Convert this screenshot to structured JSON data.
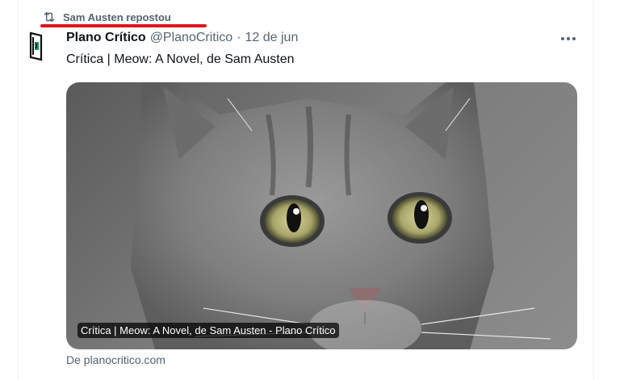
{
  "repost": {
    "label": "Sam Austen repostou",
    "icon": "repost-icon"
  },
  "post": {
    "author_name": "Plano Crítico",
    "author_handle": "@PlanoCritico",
    "separator": "·",
    "date": "12 de jun",
    "more_label": "···",
    "text": "Crítica | Meow: A Novel, de Sam Austen"
  },
  "media": {
    "caption": "Crítica | Meow: A Novel, de Sam Austen - Plano Crítico",
    "image": "gray-tabby-kitten-photo"
  },
  "source": {
    "text": "De planocritico.com"
  },
  "colors": {
    "secondary_text": "#536471",
    "primary_text": "#0f1419",
    "highlight_underline": "#e0151d"
  }
}
